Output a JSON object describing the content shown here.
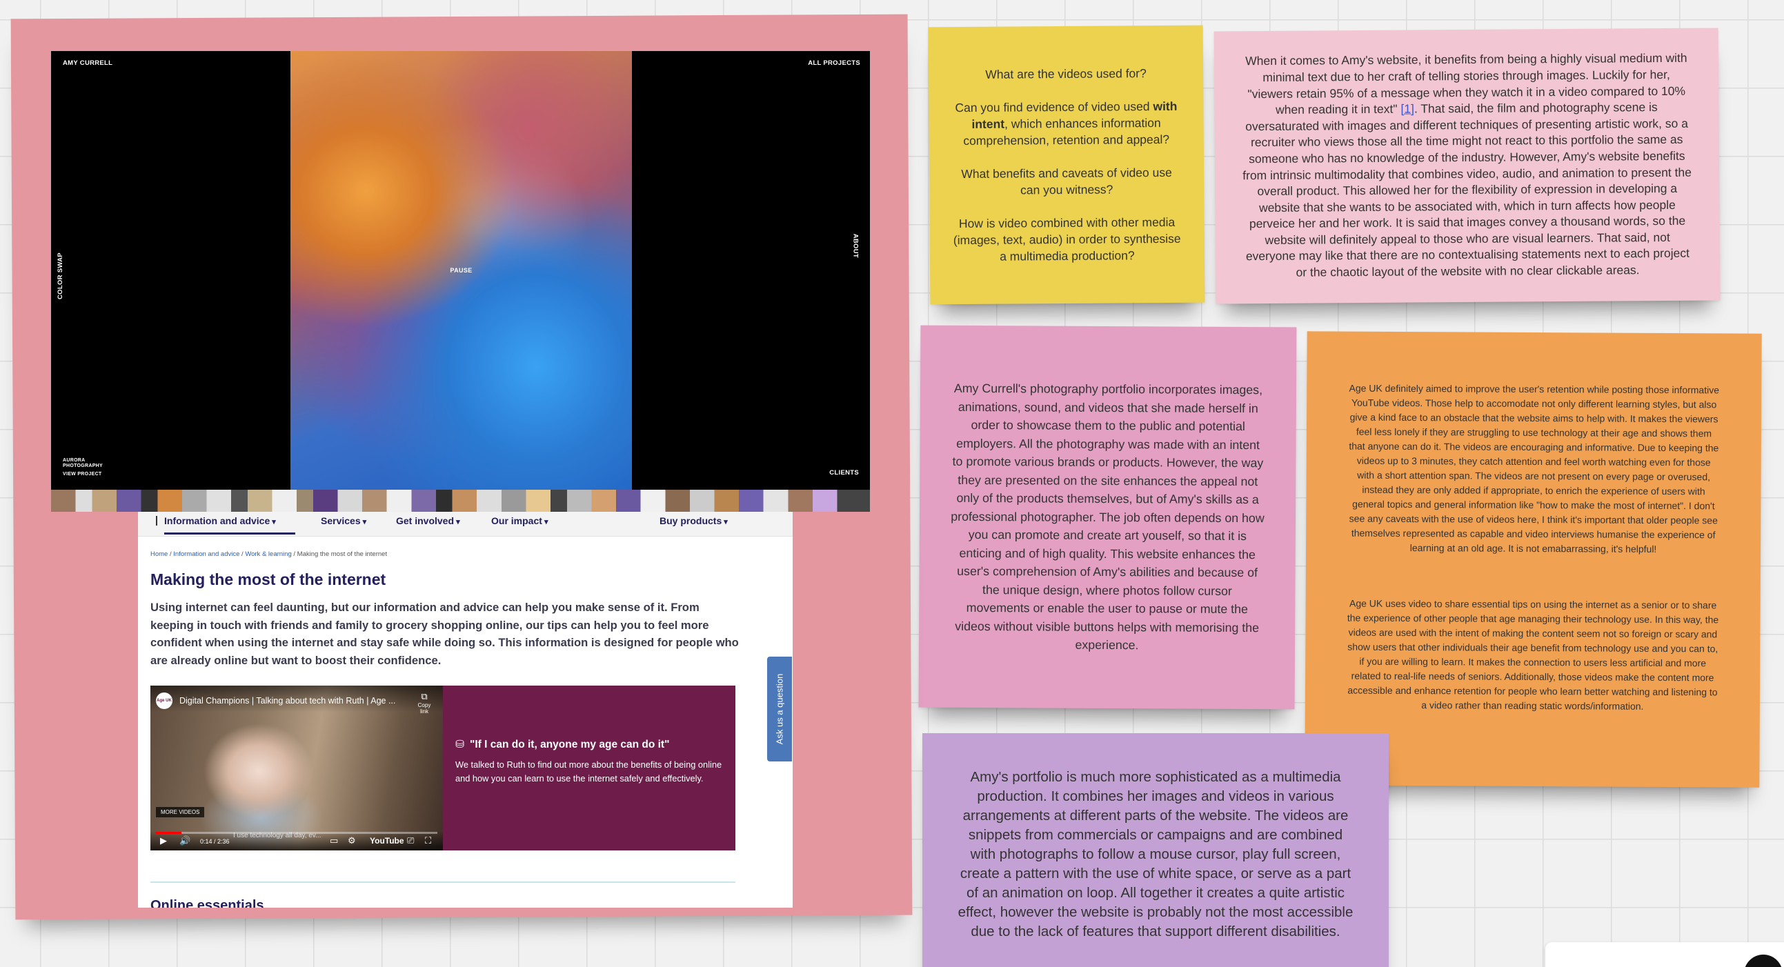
{
  "notes": {
    "yellow": {
      "q1": "What are the videos used for?",
      "q2_pre": "Can you find evidence of video used ",
      "q2_bold": "with intent",
      "q2_post": ", which enhances information comprehension, retention and appeal?",
      "q3": "What benefits and caveats of video use can you witness?",
      "q4": "How is video combined with other media (images, text, audio) in order to synthesise a multimedia production?"
    },
    "pink_light": {
      "text_pre": "When it comes to Amy's website, it benefits from being a highly visual medium with minimal text due to her craft of telling stories through images. Luckily for her, \"viewers retain 95% of a message when they watch it in a video compared to 10% when reading it in text\" ",
      "cite": "[1]",
      "text_post": ". That said, the film and photography scene is oversaturated with images and different techniques of presenting artistic work, so a recruiter who views those all the time might not react to this portfolio the same as someone who has no knowledge of the industry. However, Amy's website benefits from intrinsic multimodality that combines video, audio, and animation to present the overall product. This allowed her for the flexibility of expression in developing a website that she wants to be associated with, which in turn affects how people perveice her and her work. It is said that images convey a thousand words, so the website will definitely appeal to those who are visual learners. That said, not everyone may like that there are no contextualising statements next to each project or the chaotic layout of the website with no clear clickable areas."
    },
    "mauve": {
      "text": "Amy Currell's photography portfolio incorporates images, animations, sound, and videos that she made herself in order to showcase them to the public and potential employers. All the photography was made with an intent to promote various brands or products. However, the way they are presented on the site enhances the appeal not only of the products themselves, but of Amy's skills as a professional photographer. The job often depends on how you can promote and create art youself, so that it is enticing and of high quality. This website enhances the user's comprehension of Amy's abilities and because of the unique design, where photos follow cursor movements or enable the user to pause or mute the videos without visible buttons helps with memorising the experience."
    },
    "orange": {
      "p1": "Age UK definitely aimed to improve the user's retention while posting those informative YouTube videos. Those help to accomodate not only different learning styles, but also give a kind face to an obstacle that the website aims to help with. It makes the viewers feel less lonely if they are struggling to use technology at their age and shows them that anyone can do it. The videos are encouraging and informative. Due to keeping the videos up to 3 minutes, they catch attention and feel worth watching even for those with a short attention span. The videos are not present on every page or overused, instead they are only added if appropriate, to enrich the experience of users with general topics and general information like \"how to make the most of internet\". I don't see any caveats with the use of videos here, I think it's important that older people see themselves represented as capable and video interviews humanise the experience of learning at an old age. It is not emabarrassing, it's helpful!",
      "p2": "Age UK uses video to share essential tips on using the internet as a senior or to share the experience of other people that age managing their technology use. In this way, the videos are used with the intent of making the content seem not so foreign or scary and show users that other individuals their age benefit from technology use and you can to, if you are willing to learn. It makes the connection to users less artificial and more related to real-life needs of seniors. Additionally, those videos make the content more accessible and enhance retention for people who learn better watching and listening to a video rather than reading static words/information."
    },
    "purple": {
      "text": "Amy's portfolio is much more sophisticated as a multimedia production. It combines her images and videos in various arrangements at different parts of the website. The videos are snippets from commercials or campaigns and are combined with photographs to follow a mouse cursor, play full screen, create a pattern with the use of white space, or serve as a part of an animation on loop. All together it creates a quite artistic effect, however the website is probably not the most accessible due to the lack of features that support different disabilities."
    }
  },
  "portfolio": {
    "brand": "AMY CURRELL",
    "all_projects": "ALL PROJECTS",
    "left_side": "COLOR SWAP",
    "right_side": "ABOUT",
    "clients": "CLIENTS",
    "aurora": "AURORA PHOTOGRAPHY",
    "view_project": "VIEW PROJECT",
    "pause": "PAUSE"
  },
  "ageuk": {
    "nav": [
      {
        "label": "Information and advice"
      },
      {
        "label": "Services"
      },
      {
        "label": "Get involved"
      },
      {
        "label": "Our impact"
      },
      {
        "label": "Buy products"
      }
    ],
    "breadcrumb": [
      "Home",
      "Information and advice",
      "Work & learning",
      "Making the most of the internet"
    ],
    "title": "Making the most of the internet",
    "intro": "Using internet can feel daunting, but our information and advice can help you make sense of it. From keeping in touch with friends and family to grocery shopping online, our tips can help you to feel more confident when using the internet and stay safe while doing so. This information is designed for people who are already online but want to boost their confidence.",
    "video": {
      "title": "Digital Champions | Talking about tech with Ruth | Age ...",
      "copy_link": "Copy link",
      "more_videos": "MORE VIDEOS",
      "caption": "I use technology all day, ev...",
      "time": "0:14 / 2:36",
      "brand": "YouTube",
      "progress": 0.09,
      "logo_text": "Age UK"
    },
    "quote": {
      "heading": "\"If I can do it, anyone my age can do it\"",
      "body": "We talked to Ruth to find out more about the benefits of being online and how you can learn to use the internet safely and effectively."
    },
    "next_heading": "Online essentials",
    "ask_tab": "Ask us a question"
  }
}
